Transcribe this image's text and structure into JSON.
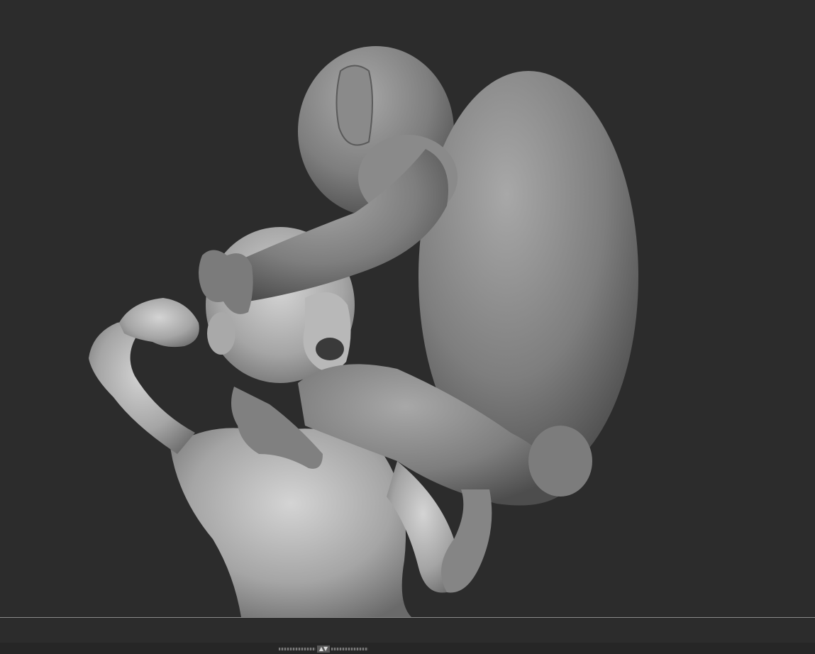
{
  "viewport": {
    "background_color": "#2c2c2c",
    "model_color": "#8f8f8f",
    "scene_description_hidden": ""
  },
  "bottom_tray": {
    "handle_icon": "expand-collapse-arrows-icon",
    "up_glyph": "▲",
    "down_glyph": "▼"
  }
}
